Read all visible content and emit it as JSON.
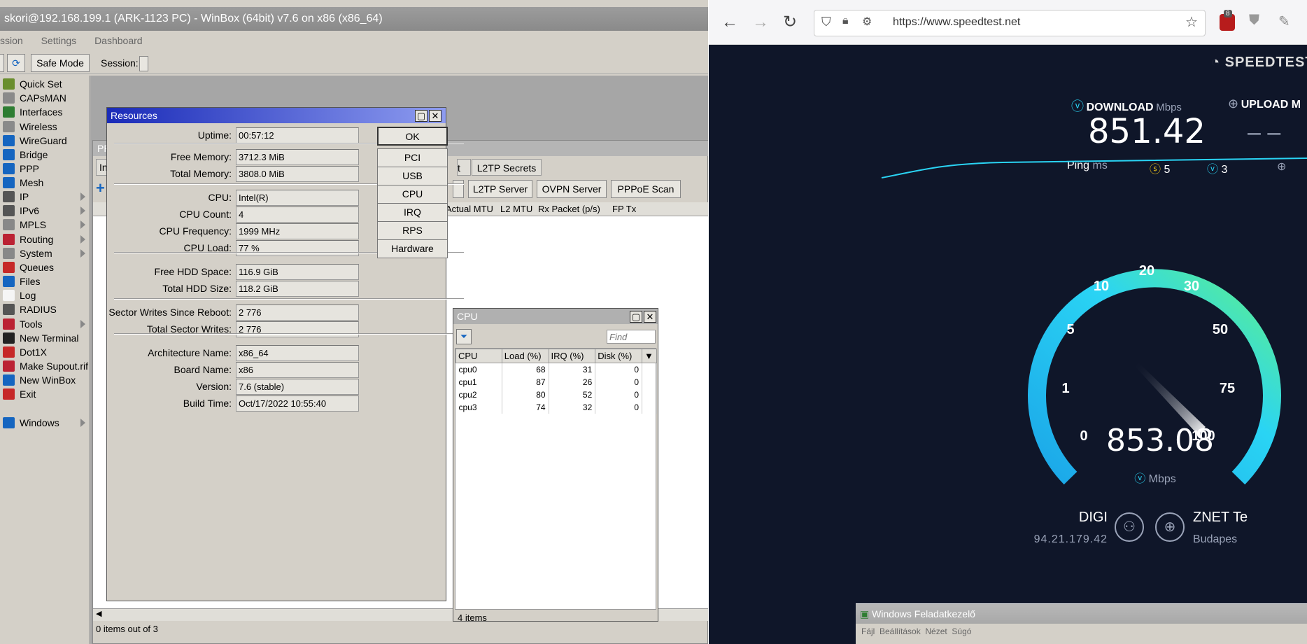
{
  "winbox": {
    "title": "skori@192.168.199.1 (ARK-1123 PC) - WinBox (64bit) v7.6 on x86 (x86_64)",
    "menu": [
      "ssion",
      "Settings",
      "Dashboard"
    ],
    "toolbar": {
      "safe_mode": "Safe Mode",
      "session_label": "Session:"
    },
    "sidebar": [
      {
        "label": "Quick Set",
        "icon": "quickset-icon",
        "sub": false,
        "color": "#6a8e2e"
      },
      {
        "label": "CAPsMAN",
        "icon": "capsman-icon",
        "sub": false,
        "color": "#8a8a8a"
      },
      {
        "label": "Interfaces",
        "icon": "interfaces-icon",
        "sub": false,
        "color": "#2e7d32"
      },
      {
        "label": "Wireless",
        "icon": "wireless-icon",
        "sub": false,
        "color": "#8a8a8a"
      },
      {
        "label": "WireGuard",
        "icon": "wireguard-icon",
        "sub": false,
        "color": "#1565c0"
      },
      {
        "label": "Bridge",
        "icon": "bridge-icon",
        "sub": false,
        "color": "#1565c0"
      },
      {
        "label": "PPP",
        "icon": "ppp-icon",
        "sub": false,
        "color": "#1565c0"
      },
      {
        "label": "Mesh",
        "icon": "mesh-icon",
        "sub": false,
        "color": "#1565c0"
      },
      {
        "label": "IP",
        "icon": "ip-icon",
        "sub": true,
        "color": "#555"
      },
      {
        "label": "IPv6",
        "icon": "ipv6-icon",
        "sub": true,
        "color": "#555"
      },
      {
        "label": "MPLS",
        "icon": "mpls-icon",
        "sub": true,
        "color": "#888"
      },
      {
        "label": "Routing",
        "icon": "routing-icon",
        "sub": true,
        "color": "#b23"
      },
      {
        "label": "System",
        "icon": "system-icon",
        "sub": true,
        "color": "#888"
      },
      {
        "label": "Queues",
        "icon": "queues-icon",
        "sub": false,
        "color": "#c62828"
      },
      {
        "label": "Files",
        "icon": "files-icon",
        "sub": false,
        "color": "#1565c0"
      },
      {
        "label": "Log",
        "icon": "log-icon",
        "sub": false,
        "color": "#f5f5f5"
      },
      {
        "label": "RADIUS",
        "icon": "radius-icon",
        "sub": false,
        "color": "#555"
      },
      {
        "label": "Tools",
        "icon": "tools-icon",
        "sub": true,
        "color": "#b23"
      },
      {
        "label": "New Terminal",
        "icon": "terminal-icon",
        "sub": false,
        "color": "#222"
      },
      {
        "label": "Dot1X",
        "icon": "dot1x-icon",
        "sub": false,
        "color": "#c62828"
      },
      {
        "label": "Make Supout.rif",
        "icon": "supout-icon",
        "sub": false,
        "color": "#b23"
      },
      {
        "label": "New WinBox",
        "icon": "newwinbox-icon",
        "sub": false,
        "color": "#1565c0"
      },
      {
        "label": "Exit",
        "icon": "exit-icon",
        "sub": false,
        "color": "#c62828"
      },
      {
        "label": "Windows",
        "icon": "windows-icon",
        "sub": true,
        "color": "#1565c0"
      }
    ],
    "ppp": {
      "title_frag": "PP",
      "tab_frag": "Int",
      "tabs": [
        "t",
        "L2TP Secrets"
      ],
      "buttons": [
        "L2TP Server",
        "OVPN Server",
        "PPPoE Scan"
      ],
      "cols": [
        "Actual MTU",
        "L2 MTU",
        "Rx Packet (p/s)",
        "FP Tx"
      ],
      "status": "0 items out of 3"
    },
    "resources": {
      "title": "Resources",
      "fields": [
        {
          "label": "Uptime:",
          "value": "00:57:12"
        },
        {
          "label": "Free Memory:",
          "value": "3712.3 MiB"
        },
        {
          "label": "Total Memory:",
          "value": "3808.0 MiB"
        },
        {
          "label": "CPU:",
          "value": "Intel(R)"
        },
        {
          "label": "CPU Count:",
          "value": "4"
        },
        {
          "label": "CPU Frequency:",
          "value": "1999 MHz"
        },
        {
          "label": "CPU Load:",
          "value": "77 %"
        },
        {
          "label": "Free HDD Space:",
          "value": "116.9 GiB"
        },
        {
          "label": "Total HDD Size:",
          "value": "118.2 GiB"
        },
        {
          "label": "Sector Writes Since Reboot:",
          "value": "2 776"
        },
        {
          "label": "Total Sector Writes:",
          "value": "2 776"
        },
        {
          "label": "Architecture Name:",
          "value": "x86_64"
        },
        {
          "label": "Board Name:",
          "value": "x86"
        },
        {
          "label": "Version:",
          "value": "7.6 (stable)"
        },
        {
          "label": "Build Time:",
          "value": "Oct/17/2022 10:55:40"
        }
      ],
      "buttons": [
        "OK",
        "PCI",
        "USB",
        "CPU",
        "IRQ",
        "RPS",
        "Hardware"
      ]
    },
    "cpu": {
      "title": "CPU",
      "find_placeholder": "Find",
      "headers": [
        "CPU",
        "Load (%)",
        "IRQ (%)",
        "Disk (%)"
      ],
      "rows": [
        [
          "cpu0",
          "68",
          "31",
          "0"
        ],
        [
          "cpu1",
          "87",
          "26",
          "0"
        ],
        [
          "cpu2",
          "80",
          "52",
          "0"
        ],
        [
          "cpu3",
          "74",
          "32",
          "0"
        ]
      ],
      "status": "4 items"
    }
  },
  "browser": {
    "url": "https://www.speedtest.net",
    "badge": "8",
    "brand": "SPEEDTEST",
    "download_label": "DOWNLOAD",
    "download_unit": "Mbps",
    "download_value": "851.42",
    "upload_label": "UPLOAD M",
    "upload_value": "– –",
    "ping_label": "Ping",
    "ping_unit": "ms",
    "ping_idle": "5",
    "ping_down": "3",
    "gauge_ticks": [
      "0",
      "1",
      "5",
      "10",
      "20",
      "30",
      "50",
      "75",
      "100"
    ],
    "gauge_value": "853.08",
    "gauge_unit": "Mbps",
    "isp": "DIGI",
    "ip": "94.21.179.42",
    "server": "ZNET Te",
    "server_city": "Budapes",
    "taskmgr_title": "Windows Feladatkezelő",
    "taskmgr_menu": "Fájl  Beállítások  Nézet  Súgó",
    "colors": {
      "bg": "#0f1629",
      "cyan": "#2ad4f4",
      "green": "#5ef08c"
    }
  }
}
